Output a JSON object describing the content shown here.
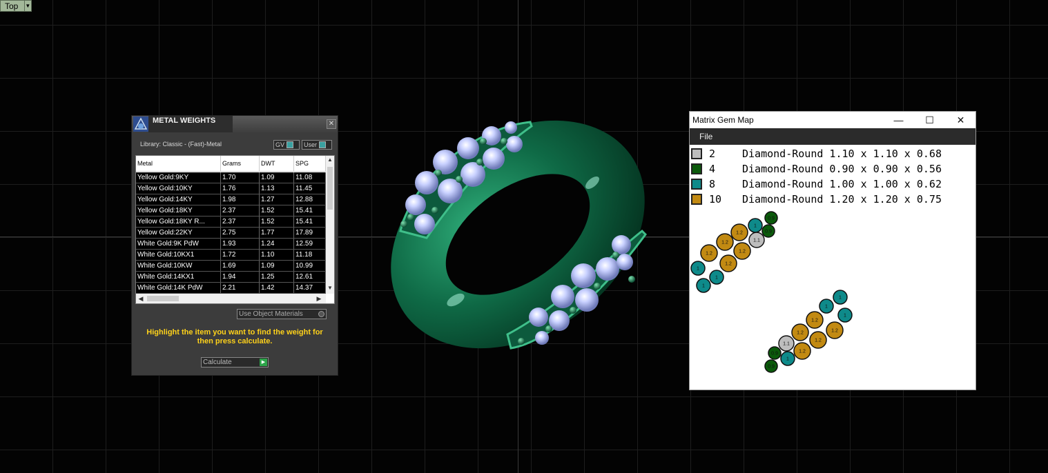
{
  "viewport": {
    "view_label": "Top"
  },
  "metal_weights": {
    "title": "METAL WEIGHTS",
    "close_glyph": "✕",
    "library": "Library: Classic - (Fast)-Metal",
    "toggle_gv": "GV",
    "toggle_user": "User",
    "columns": [
      "Metal",
      "Grams",
      "DWT",
      "SPG"
    ],
    "rows": [
      [
        "Yellow Gold:9KY",
        "1.70",
        "1.09",
        "11.08"
      ],
      [
        "Yellow Gold:10KY",
        "1.76",
        "1.13",
        "11.45"
      ],
      [
        "Yellow Gold:14KY",
        "1.98",
        "1.27",
        "12.88"
      ],
      [
        "Yellow Gold:18KY",
        "2.37",
        "1.52",
        "15.41"
      ],
      [
        "Yellow Gold:18KY R...",
        "2.37",
        "1.52",
        "15.41"
      ],
      [
        "Yellow Gold:22KY",
        "2.75",
        "1.77",
        "17.89"
      ],
      [
        "White Gold:9K PdW",
        "1.93",
        "1.24",
        "12.59"
      ],
      [
        "White Gold:10KX1",
        "1.72",
        "1.10",
        "11.18"
      ],
      [
        "White Gold:10KW",
        "1.69",
        "1.09",
        "10.99"
      ],
      [
        "White Gold:14KX1",
        "1.94",
        "1.25",
        "12.61"
      ],
      [
        "White Gold:14K PdW",
        "2.21",
        "1.42",
        "14.37"
      ]
    ],
    "use_object_materials": "Use Object Materials",
    "help_text": "Highlight the item you want to find the weight for then press calculate.",
    "calculate_label": "Calculate"
  },
  "gem_map": {
    "title": "Matrix Gem Map",
    "minimize": "—",
    "maximize": "☐",
    "close": "✕",
    "menu_file": "File",
    "legend": [
      {
        "count": "2",
        "desc": "Diamond-Round 1.10 x 1.10 x 0.68",
        "color": "#bdbdbd"
      },
      {
        "count": "4",
        "desc": "Diamond-Round 0.90 x 0.90 x 0.56",
        "color": "#0b5a0b"
      },
      {
        "count": "8",
        "desc": "Diamond-Round 1.00 x 1.00 x 0.62",
        "color": "#0e8a8a"
      },
      {
        "count": "10",
        "desc": "Diamond-Round 1.20 x 1.20 x 0.75",
        "color": "#c28a12"
      }
    ],
    "stone_labels": {
      "gray": "1.1",
      "green": "0.9",
      "teal": "1",
      "gold": "1.2"
    }
  }
}
